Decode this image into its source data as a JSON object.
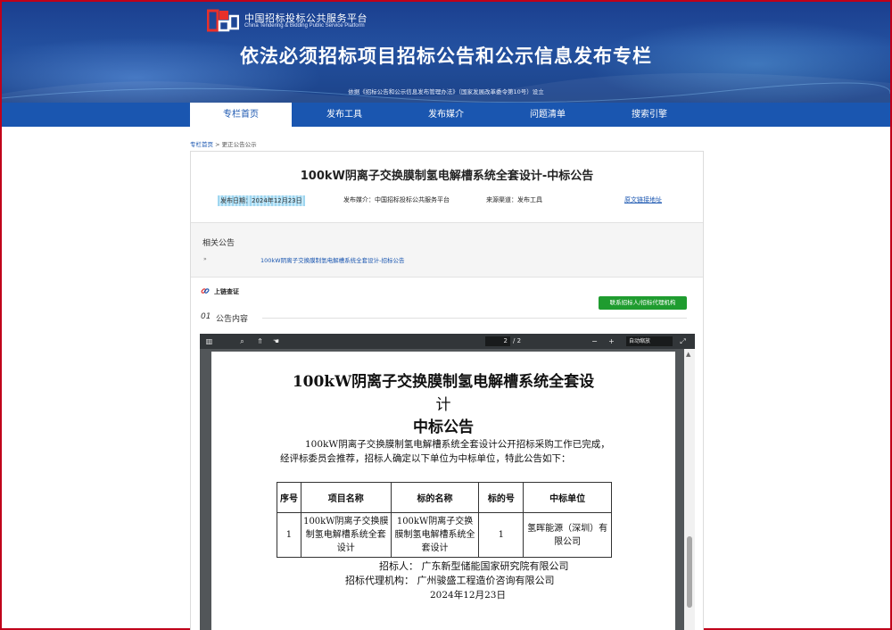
{
  "header": {
    "logo_cn": "中国招标投标公共服务平台",
    "logo_en": "China Tendering & Bidding Public Service Platform",
    "title": "依法必须招标项目招标公告和公示信息发布专栏",
    "subtitle": "依据《招标公告和公示信息发布管理办法》（国家发展改革委令第10号）设立"
  },
  "nav": {
    "items": [
      {
        "label": "专栏首页"
      },
      {
        "label": "发布工具"
      },
      {
        "label": "发布媒介"
      },
      {
        "label": "问题清单"
      },
      {
        "label": "搜索引擎"
      }
    ]
  },
  "breadcrumb": {
    "home": "专栏首页",
    "sep": " > ",
    "current": "更正公告公示"
  },
  "notice": {
    "title": "100kW阴离子交换膜制氢电解槽系统全套设计-中标公告",
    "date": "发布日期：2024年12月23日",
    "media": "发布媒介：中国招标投标公共服务平台",
    "source": "来源渠道：发布工具",
    "original_link": "原文链接地址"
  },
  "related": {
    "heading": "相关公告",
    "bullet": "»",
    "link": "100kW阴离子交换膜制氢电解槽系统全套设计-招标公告"
  },
  "chain": {
    "label": "上链查证",
    "contact_button": "联系招标人/招标代理机构"
  },
  "section": {
    "num": "01",
    "label": "公告内容"
  },
  "pdf_toolbar": {
    "page": "2",
    "total": "/ 2",
    "zoom": "自动缩放",
    "minus": "−",
    "plus": "+"
  },
  "pdf": {
    "title_line1": "100kW阴离子交换膜制氢电解槽系统全套设",
    "title_line2": "计",
    "title_line3": "中标公告",
    "para": "100kW阴离子交换膜制氢电解槽系统全套设计公开招标采购工作已完成，经评标委员会推荐，招标人确定以下单位为中标单位，特此公告如下：",
    "table": {
      "headers": [
        "序号",
        "项目名称",
        "标的名称",
        "标的号",
        "中标单位"
      ],
      "rows": [
        [
          "1",
          "100kW阴离子交换膜制氢电解槽系统全套设计",
          "100kW阴离子交换膜制氢电解槽系统全套设计",
          "1",
          "氢晖能源（深圳）有限公司"
        ]
      ]
    },
    "tenderer": "招标人：  广东新型储能国家研究院有限公司",
    "agency": "招标代理机构：  广州骏盛工程造价咨询有限公司",
    "date": "2024年12月23日"
  }
}
